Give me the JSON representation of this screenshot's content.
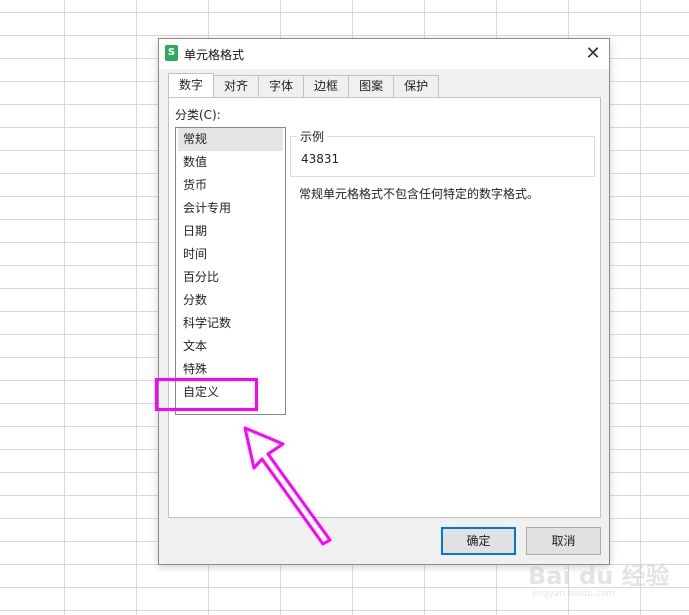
{
  "dialog": {
    "icon_letter": "S",
    "title": "单元格格式",
    "close_label": "✕"
  },
  "tabs": [
    {
      "label": "数字",
      "active": true
    },
    {
      "label": "对齐"
    },
    {
      "label": "字体"
    },
    {
      "label": "边框"
    },
    {
      "label": "图案"
    },
    {
      "label": "保护"
    }
  ],
  "category": {
    "label": "分类(C):",
    "items": [
      "常规",
      "数值",
      "货币",
      "会计专用",
      "日期",
      "时间",
      "百分比",
      "分数",
      "科学记数",
      "文本",
      "特殊",
      "自定义"
    ],
    "selected": "常规"
  },
  "sample": {
    "legend": "示例",
    "value": "43831"
  },
  "description": "常规单元格格式不包含任何特定的数字格式。",
  "buttons": {
    "ok": "确定",
    "cancel": "取消"
  },
  "annotation": {
    "color": "#ff00ff",
    "highlighted_item": "自定义"
  },
  "watermark": {
    "logo": "Bai du 经验",
    "url": "jingyan.baidu.com"
  },
  "colors": {
    "accent": "#0078d7",
    "app_icon": "#2eaa5c"
  }
}
